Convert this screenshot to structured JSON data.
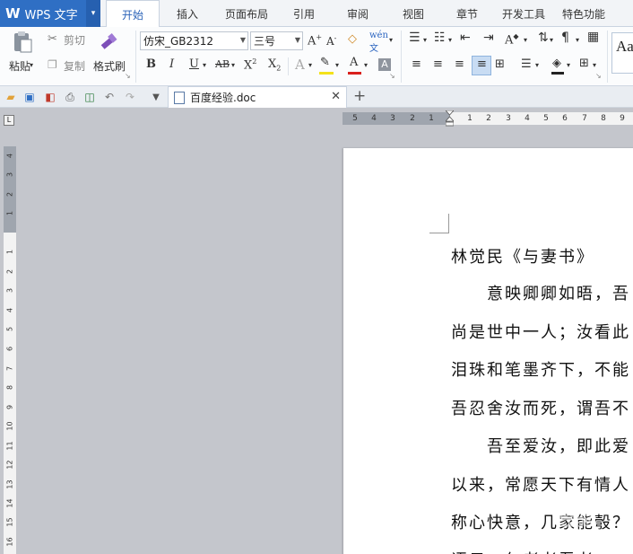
{
  "app": {
    "name": "WPS 文字",
    "menu_caret": "▾"
  },
  "tabs": [
    "开始",
    "插入",
    "页面布局",
    "引用",
    "审阅",
    "视图",
    "章节",
    "开发工具",
    "特色功能"
  ],
  "ribbon": {
    "paste_label": "粘贴",
    "cut_label": "剪切",
    "copy_label": "复制",
    "format_painter_label": "格式刷",
    "font_name": "仿宋_GB2312",
    "font_size": "三号",
    "style_preview": "Aa"
  },
  "document": {
    "tab_title": "百度经验.doc",
    "lines": [
      "林觉民《与妻书》",
      "　　意映卿卿如晤，吾",
      "尚是世中一人；汝看此",
      "泪珠和笔墨齐下，不能",
      "吾忍舍汝而死，谓吾不",
      "　　吾至爱汝，即此爱",
      "以来，常愿天下有情人",
      "称心快意，几家能彀？",
      "语云，仁者老吾老"
    ]
  },
  "hruler_numbers": [
    "5",
    "4",
    "3",
    "2",
    "1",
    "1",
    "2",
    "3",
    "4",
    "5",
    "6",
    "7",
    "8",
    "9"
  ],
  "vruler_numbers": [
    "4",
    "3",
    "2",
    "1",
    "1",
    "2",
    "3",
    "4",
    "5",
    "6",
    "7",
    "8",
    "9",
    "10",
    "11",
    "12",
    "13",
    "14",
    "15",
    "16"
  ],
  "watermark": "经验",
  "colors": {
    "accent": "#2f6fc4",
    "active_tab_text": "#2b63b8"
  }
}
